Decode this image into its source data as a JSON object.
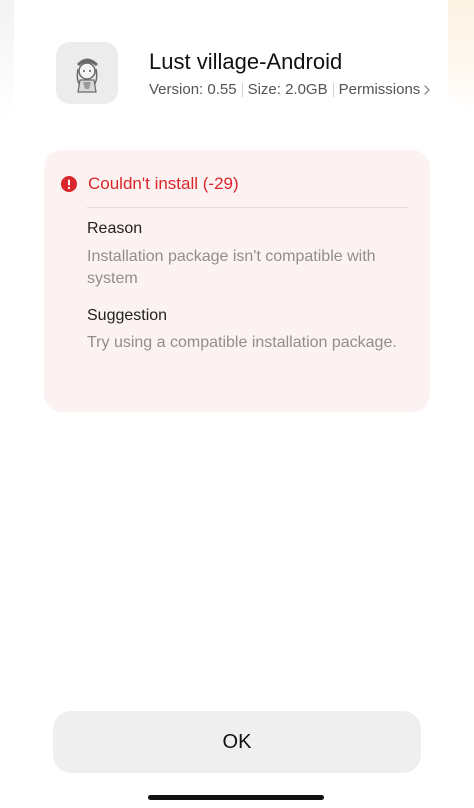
{
  "app": {
    "name": "Lust village-Android",
    "version": "Version: 0.55",
    "size": "Size: 2.0GB",
    "permissions_label": "Permissions",
    "icon": "app-thumbnail"
  },
  "error": {
    "title": "Couldn't install (-29)",
    "icon": "alert-circle-icon",
    "reason_label": "Reason",
    "reason_text": "Installation package isn't compatible with system",
    "suggestion_label": "Suggestion",
    "suggestion_text": "Try using a compatible installation package."
  },
  "actions": {
    "ok_label": "OK"
  },
  "colors": {
    "error_red": "#d9262b",
    "card_bg": "#fdf2f2",
    "button_bg": "#efefef"
  }
}
